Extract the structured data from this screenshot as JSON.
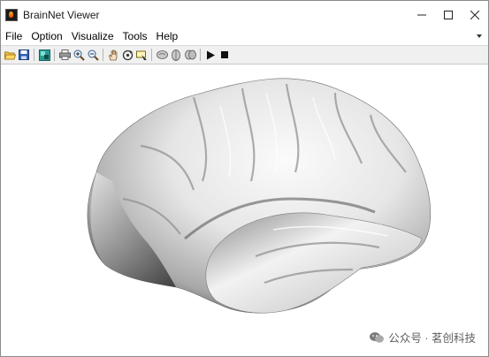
{
  "window": {
    "title": "BrainNet Viewer",
    "controls": {
      "minimize": "—",
      "maximize": "☐",
      "close": "✕"
    }
  },
  "menu": {
    "items": [
      "File",
      "Option",
      "Visualize",
      "Tools",
      "Help"
    ]
  },
  "toolbar": {
    "buttons": [
      {
        "name": "open-icon"
      },
      {
        "name": "save-icon"
      },
      {
        "name": "new-figure-icon"
      },
      {
        "name": "print-icon"
      },
      {
        "name": "zoom-in-icon"
      },
      {
        "name": "zoom-out-icon"
      },
      {
        "name": "pan-hand-icon"
      },
      {
        "name": "rotate-3d-icon"
      },
      {
        "name": "data-cursor-icon"
      },
      {
        "name": "view-sagittal-icon"
      },
      {
        "name": "view-axial-icon"
      },
      {
        "name": "view-coronal-icon"
      },
      {
        "name": "play-icon"
      },
      {
        "name": "stop-icon"
      }
    ]
  },
  "watermark": {
    "text": "公众号 · 茗创科技"
  },
  "colors": {
    "surface_light": "#f4f4f4",
    "surface_dark": "#3c3c3c",
    "toolbar_bg": "#f0f0f0"
  }
}
